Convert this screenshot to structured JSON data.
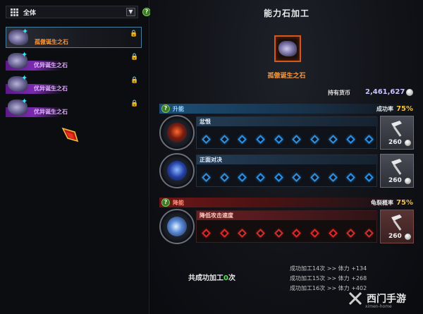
{
  "filter": {
    "label": "全体",
    "dropdown_glyph": "▼",
    "help_glyph": "?"
  },
  "stone_list": [
    {
      "name": "孤傲诞生之石",
      "selected": true,
      "color": "#ff9a3c",
      "lock_glyph": "🔒"
    },
    {
      "name": "优异诞生之石",
      "selected": false,
      "color": "#e2b0ff",
      "lock_glyph": "🔒"
    },
    {
      "name": "优异诞生之石",
      "selected": false,
      "color": "#e2b0ff",
      "lock_glyph": "🔒"
    },
    {
      "name": "优异诞生之石",
      "selected": false,
      "color": "#e2b0ff",
      "lock_glyph": "🔒"
    }
  ],
  "panel": {
    "title": "能力石加工",
    "stone_name": "孤傲诞生之石",
    "currency_label": "持有货币",
    "currency_value": "2,461,627"
  },
  "upgrade": {
    "section_title": "升能",
    "rate_label": "成功率",
    "rate_value": "75%",
    "effects": [
      {
        "name": "忿恨",
        "cost": "260",
        "slots": 10
      },
      {
        "name": "正面对决",
        "cost": "260",
        "slots": 10
      }
    ]
  },
  "downgrade": {
    "section_title": "降能",
    "rate_label": "龟裂概率",
    "rate_value": "75%",
    "effects": [
      {
        "name": "降低攻击速度",
        "cost": "260",
        "slots": 10
      }
    ]
  },
  "summary": {
    "prefix": "共成功加工",
    "count": "0",
    "suffix": "次"
  },
  "bonuses": [
    "成功加工14次 >> 体力 +134",
    "成功加工15次 >> 体力 +268",
    "成功加工16次 >> 体力 +402"
  ],
  "watermark": {
    "text": "西门手游",
    "url": "ximen-home"
  },
  "colors": {
    "accent_gold": "#f2c24a",
    "upgrade_blue": "#2f8fe0",
    "downgrade_red": "#d82c2c",
    "success_green": "#5be05b"
  },
  "icons": {
    "grid": "grid-icon",
    "help": "help-icon",
    "lock": "lock-icon",
    "hammer": "hammer-icon",
    "coin": "coin-icon"
  }
}
